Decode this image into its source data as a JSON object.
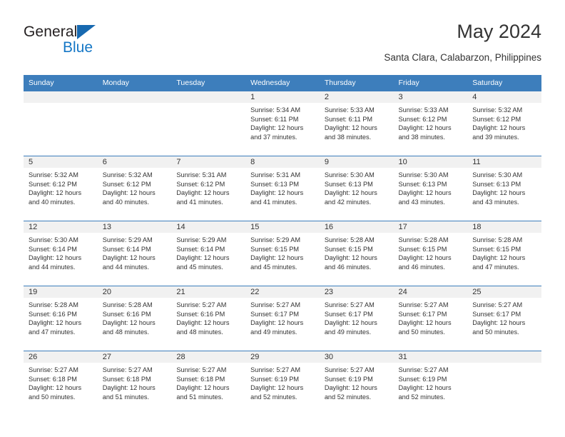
{
  "brand": {
    "name_top": "General",
    "name_bottom": "Blue",
    "triangle_color": "#1769b0",
    "blue_text_color": "#1577c6"
  },
  "header": {
    "title": "May 2024",
    "subtitle": "Santa Clara, Calabarzon, Philippines"
  },
  "theme": {
    "header_row_bg": "#3d7ebc",
    "header_row_text": "#ffffff",
    "day_number_bg": "#f1f1f1",
    "cell_text": "#333333",
    "grid_line": "#3d7ebc"
  },
  "weekday_headers": [
    "Sunday",
    "Monday",
    "Tuesday",
    "Wednesday",
    "Thursday",
    "Friday",
    "Saturday"
  ],
  "weeks": [
    [
      {
        "day": "",
        "empty": true,
        "lines": []
      },
      {
        "day": "",
        "empty": true,
        "lines": []
      },
      {
        "day": "",
        "empty": true,
        "lines": []
      },
      {
        "day": "1",
        "empty": false,
        "lines": [
          "Sunrise: 5:34 AM",
          "Sunset: 6:11 PM",
          "Daylight: 12 hours",
          "and 37 minutes."
        ]
      },
      {
        "day": "2",
        "empty": false,
        "lines": [
          "Sunrise: 5:33 AM",
          "Sunset: 6:11 PM",
          "Daylight: 12 hours",
          "and 38 minutes."
        ]
      },
      {
        "day": "3",
        "empty": false,
        "lines": [
          "Sunrise: 5:33 AM",
          "Sunset: 6:12 PM",
          "Daylight: 12 hours",
          "and 38 minutes."
        ]
      },
      {
        "day": "4",
        "empty": false,
        "lines": [
          "Sunrise: 5:32 AM",
          "Sunset: 6:12 PM",
          "Daylight: 12 hours",
          "and 39 minutes."
        ]
      }
    ],
    [
      {
        "day": "5",
        "empty": false,
        "lines": [
          "Sunrise: 5:32 AM",
          "Sunset: 6:12 PM",
          "Daylight: 12 hours",
          "and 40 minutes."
        ]
      },
      {
        "day": "6",
        "empty": false,
        "lines": [
          "Sunrise: 5:32 AM",
          "Sunset: 6:12 PM",
          "Daylight: 12 hours",
          "and 40 minutes."
        ]
      },
      {
        "day": "7",
        "empty": false,
        "lines": [
          "Sunrise: 5:31 AM",
          "Sunset: 6:12 PM",
          "Daylight: 12 hours",
          "and 41 minutes."
        ]
      },
      {
        "day": "8",
        "empty": false,
        "lines": [
          "Sunrise: 5:31 AM",
          "Sunset: 6:13 PM",
          "Daylight: 12 hours",
          "and 41 minutes."
        ]
      },
      {
        "day": "9",
        "empty": false,
        "lines": [
          "Sunrise: 5:30 AM",
          "Sunset: 6:13 PM",
          "Daylight: 12 hours",
          "and 42 minutes."
        ]
      },
      {
        "day": "10",
        "empty": false,
        "lines": [
          "Sunrise: 5:30 AM",
          "Sunset: 6:13 PM",
          "Daylight: 12 hours",
          "and 43 minutes."
        ]
      },
      {
        "day": "11",
        "empty": false,
        "lines": [
          "Sunrise: 5:30 AM",
          "Sunset: 6:13 PM",
          "Daylight: 12 hours",
          "and 43 minutes."
        ]
      }
    ],
    [
      {
        "day": "12",
        "empty": false,
        "lines": [
          "Sunrise: 5:30 AM",
          "Sunset: 6:14 PM",
          "Daylight: 12 hours",
          "and 44 minutes."
        ]
      },
      {
        "day": "13",
        "empty": false,
        "lines": [
          "Sunrise: 5:29 AM",
          "Sunset: 6:14 PM",
          "Daylight: 12 hours",
          "and 44 minutes."
        ]
      },
      {
        "day": "14",
        "empty": false,
        "lines": [
          "Sunrise: 5:29 AM",
          "Sunset: 6:14 PM",
          "Daylight: 12 hours",
          "and 45 minutes."
        ]
      },
      {
        "day": "15",
        "empty": false,
        "lines": [
          "Sunrise: 5:29 AM",
          "Sunset: 6:15 PM",
          "Daylight: 12 hours",
          "and 45 minutes."
        ]
      },
      {
        "day": "16",
        "empty": false,
        "lines": [
          "Sunrise: 5:28 AM",
          "Sunset: 6:15 PM",
          "Daylight: 12 hours",
          "and 46 minutes."
        ]
      },
      {
        "day": "17",
        "empty": false,
        "lines": [
          "Sunrise: 5:28 AM",
          "Sunset: 6:15 PM",
          "Daylight: 12 hours",
          "and 46 minutes."
        ]
      },
      {
        "day": "18",
        "empty": false,
        "lines": [
          "Sunrise: 5:28 AM",
          "Sunset: 6:15 PM",
          "Daylight: 12 hours",
          "and 47 minutes."
        ]
      }
    ],
    [
      {
        "day": "19",
        "empty": false,
        "lines": [
          "Sunrise: 5:28 AM",
          "Sunset: 6:16 PM",
          "Daylight: 12 hours",
          "and 47 minutes."
        ]
      },
      {
        "day": "20",
        "empty": false,
        "lines": [
          "Sunrise: 5:28 AM",
          "Sunset: 6:16 PM",
          "Daylight: 12 hours",
          "and 48 minutes."
        ]
      },
      {
        "day": "21",
        "empty": false,
        "lines": [
          "Sunrise: 5:27 AM",
          "Sunset: 6:16 PM",
          "Daylight: 12 hours",
          "and 48 minutes."
        ]
      },
      {
        "day": "22",
        "empty": false,
        "lines": [
          "Sunrise: 5:27 AM",
          "Sunset: 6:17 PM",
          "Daylight: 12 hours",
          "and 49 minutes."
        ]
      },
      {
        "day": "23",
        "empty": false,
        "lines": [
          "Sunrise: 5:27 AM",
          "Sunset: 6:17 PM",
          "Daylight: 12 hours",
          "and 49 minutes."
        ]
      },
      {
        "day": "24",
        "empty": false,
        "lines": [
          "Sunrise: 5:27 AM",
          "Sunset: 6:17 PM",
          "Daylight: 12 hours",
          "and 50 minutes."
        ]
      },
      {
        "day": "25",
        "empty": false,
        "lines": [
          "Sunrise: 5:27 AM",
          "Sunset: 6:17 PM",
          "Daylight: 12 hours",
          "and 50 minutes."
        ]
      }
    ],
    [
      {
        "day": "26",
        "empty": false,
        "lines": [
          "Sunrise: 5:27 AM",
          "Sunset: 6:18 PM",
          "Daylight: 12 hours",
          "and 50 minutes."
        ]
      },
      {
        "day": "27",
        "empty": false,
        "lines": [
          "Sunrise: 5:27 AM",
          "Sunset: 6:18 PM",
          "Daylight: 12 hours",
          "and 51 minutes."
        ]
      },
      {
        "day": "28",
        "empty": false,
        "lines": [
          "Sunrise: 5:27 AM",
          "Sunset: 6:18 PM",
          "Daylight: 12 hours",
          "and 51 minutes."
        ]
      },
      {
        "day": "29",
        "empty": false,
        "lines": [
          "Sunrise: 5:27 AM",
          "Sunset: 6:19 PM",
          "Daylight: 12 hours",
          "and 52 minutes."
        ]
      },
      {
        "day": "30",
        "empty": false,
        "lines": [
          "Sunrise: 5:27 AM",
          "Sunset: 6:19 PM",
          "Daylight: 12 hours",
          "and 52 minutes."
        ]
      },
      {
        "day": "31",
        "empty": false,
        "lines": [
          "Sunrise: 5:27 AM",
          "Sunset: 6:19 PM",
          "Daylight: 12 hours",
          "and 52 minutes."
        ]
      },
      {
        "day": "",
        "empty": true,
        "lines": []
      }
    ]
  ]
}
